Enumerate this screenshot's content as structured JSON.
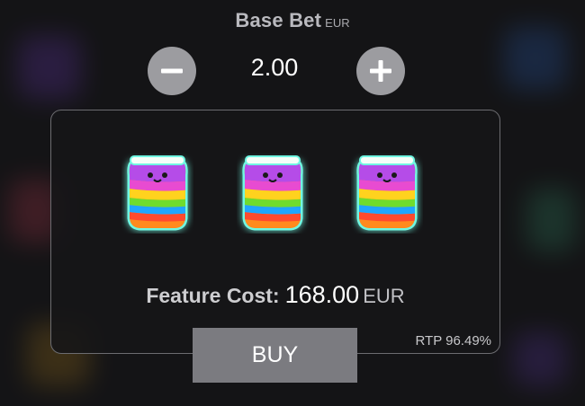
{
  "base_bet": {
    "label": "Base Bet",
    "currency": "EUR",
    "value": "2.00",
    "decrease_icon": "minus-icon",
    "increase_icon": "plus-icon"
  },
  "feature": {
    "symbols": [
      "rainbow-jar-icon",
      "rainbow-jar-icon",
      "rainbow-jar-icon"
    ],
    "cost_label": "Feature Cost:",
    "cost_value": "168.00",
    "cost_currency": "EUR",
    "rtp": "RTP 96.49%"
  },
  "buy_button": {
    "label": "BUY"
  },
  "colors": {
    "background": "#141416",
    "button_grey": "#9c9ca0",
    "buy_grey": "#7b7b80",
    "jar_glow": "#5af0dc"
  }
}
